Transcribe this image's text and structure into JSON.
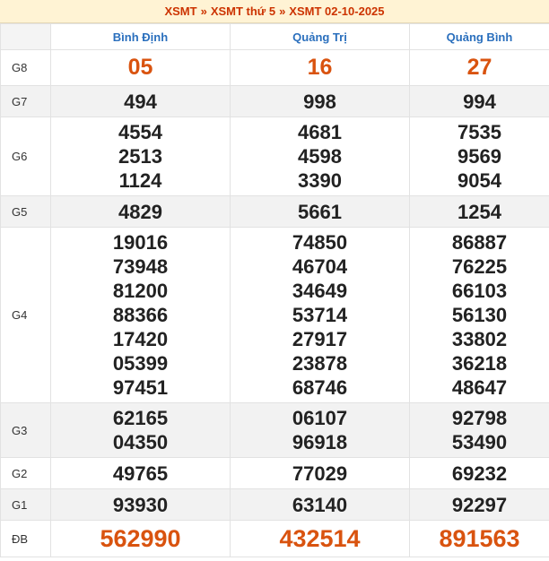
{
  "breadcrumb": {
    "link1": "XSMT",
    "sep1": "»",
    "link2": "XSMT thứ 5",
    "sep2": "»",
    "link3": "XSMT 02-10-2025"
  },
  "provinces": [
    "Bình Định",
    "Quảng Trị",
    "Quảng Bình"
  ],
  "rows": {
    "g8": {
      "label": "G8",
      "values": [
        [
          "05"
        ],
        [
          "16"
        ],
        [
          "27"
        ]
      ]
    },
    "g7": {
      "label": "G7",
      "values": [
        [
          "494"
        ],
        [
          "998"
        ],
        [
          "994"
        ]
      ]
    },
    "g6": {
      "label": "G6",
      "values": [
        [
          "4554",
          "2513",
          "1124"
        ],
        [
          "4681",
          "4598",
          "3390"
        ],
        [
          "7535",
          "9569",
          "9054"
        ]
      ]
    },
    "g5": {
      "label": "G5",
      "values": [
        [
          "4829"
        ],
        [
          "5661"
        ],
        [
          "1254"
        ]
      ]
    },
    "g4": {
      "label": "G4",
      "values": [
        [
          "19016",
          "73948",
          "81200",
          "88366",
          "17420",
          "05399",
          "97451"
        ],
        [
          "74850",
          "46704",
          "34649",
          "53714",
          "27917",
          "23878",
          "68746"
        ],
        [
          "86887",
          "76225",
          "66103",
          "56130",
          "33802",
          "36218",
          "48647"
        ]
      ]
    },
    "g3": {
      "label": "G3",
      "values": [
        [
          "62165",
          "04350"
        ],
        [
          "06107",
          "96918"
        ],
        [
          "92798",
          "53490"
        ]
      ]
    },
    "g2": {
      "label": "G2",
      "values": [
        [
          "49765"
        ],
        [
          "77029"
        ],
        [
          "69232"
        ]
      ]
    },
    "g1": {
      "label": "G1",
      "values": [
        [
          "93930"
        ],
        [
          "63140"
        ],
        [
          "92297"
        ]
      ]
    },
    "db": {
      "label": "ĐB",
      "values": [
        [
          "562990"
        ],
        [
          "432514"
        ],
        [
          "891563"
        ]
      ]
    }
  }
}
